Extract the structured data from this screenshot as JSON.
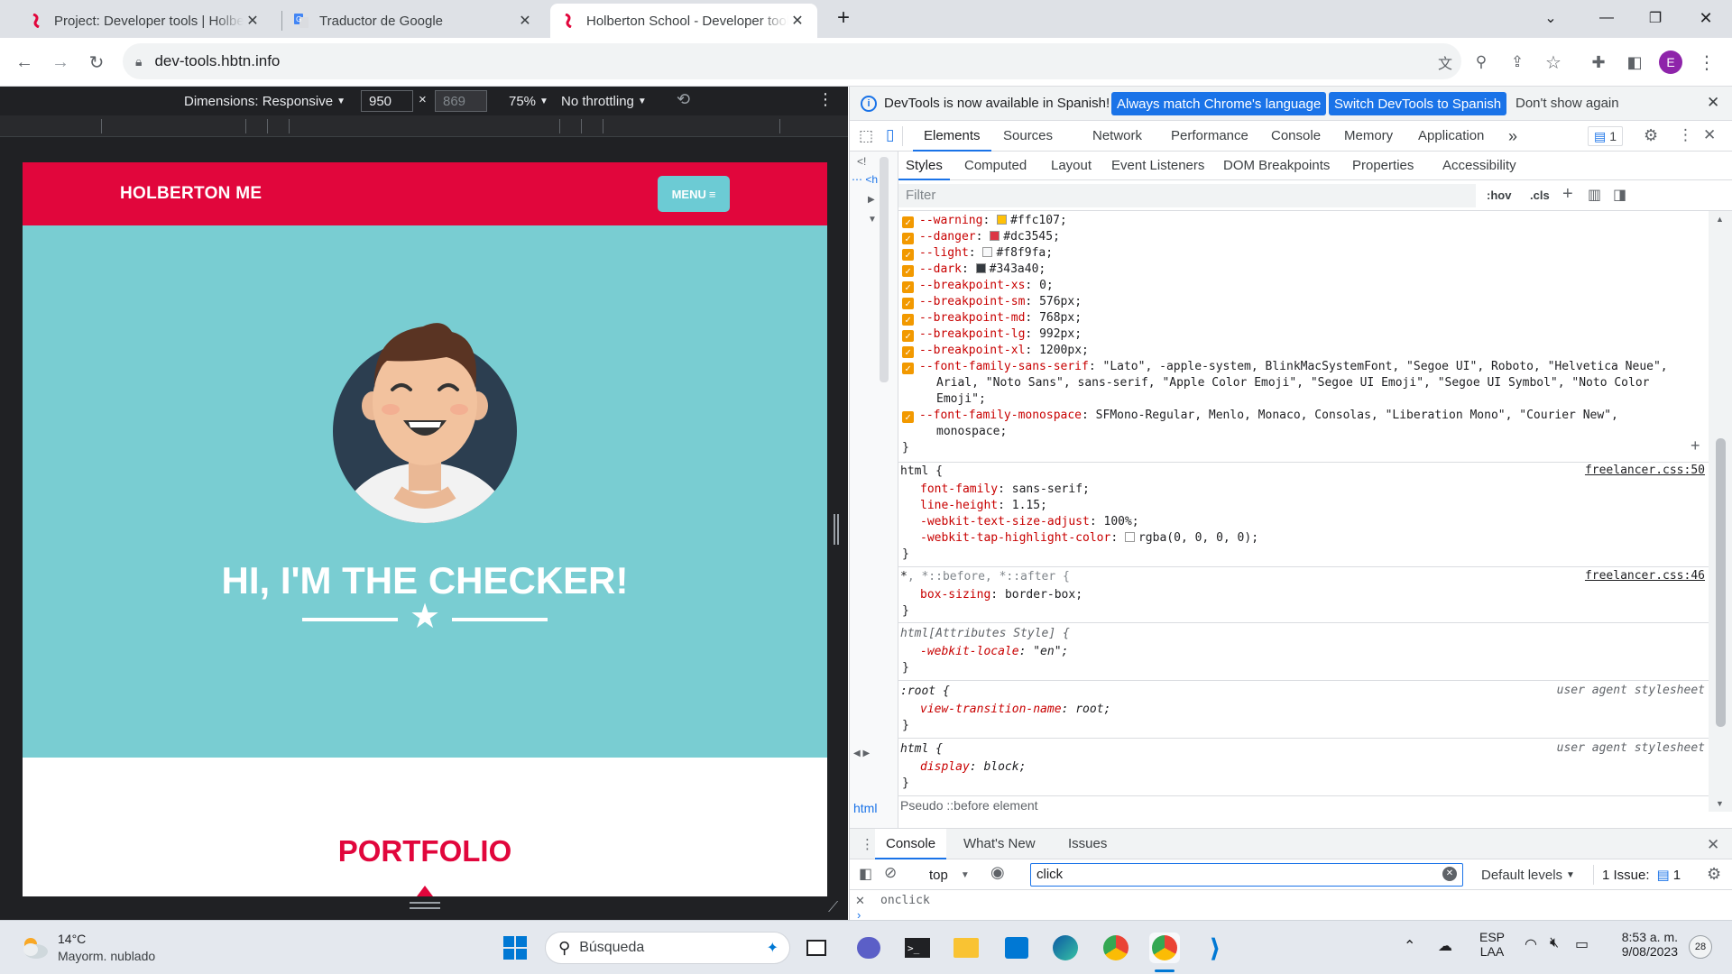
{
  "browser": {
    "tabs": [
      {
        "title": "Project: Developer tools | Holberton",
        "favicon": "holberton-icon"
      },
      {
        "title": "Traductor de Google",
        "favicon": "google-translate-icon"
      },
      {
        "title": "Holberton School - Developer tools",
        "favicon": "holberton-icon",
        "active": true
      }
    ],
    "url": "dev-tools.hbtn.info"
  },
  "device_toolbar": {
    "dimensions": "Dimensions: Responsive",
    "width": "950",
    "height_placeholder": "869",
    "times": "×",
    "zoom": "75%",
    "throttling": "No throttling"
  },
  "site": {
    "brand": "HOLBERTON ME",
    "menu": "MENU",
    "hero_title": "HI, I'M THE CHECKER!",
    "portfolio": "PORTFOLIO",
    "colors": {
      "nav": "#e1063c",
      "hero": "#79cdd2",
      "menu_button": "#6ccbd4"
    }
  },
  "devtools": {
    "infobar": {
      "message": "DevTools is now available in Spanish!",
      "btn_match": "Always match Chrome's language",
      "btn_switch": "Switch DevTools to Spanish",
      "btn_dismiss": "Don't show again"
    },
    "main_tabs": [
      "Elements",
      "Sources",
      "Network",
      "Performance",
      "Console",
      "Memory",
      "Application"
    ],
    "issues_count": "1",
    "sub_tabs": [
      "Styles",
      "Computed",
      "Layout",
      "Event Listeners",
      "DOM Breakpoints",
      "Properties",
      "Accessibility"
    ],
    "filter_placeholder": "Filter",
    "hov": ":hov",
    "cls": ".cls",
    "vars": [
      {
        "name": "--warning",
        "value": "#ffc107",
        "swatch": "#ffc107"
      },
      {
        "name": "--danger",
        "value": "#dc3545",
        "swatch": "#dc3545"
      },
      {
        "name": "--light",
        "value": "#f8f9fa",
        "swatch": "#f8f9fa"
      },
      {
        "name": "--dark",
        "value": "#343a40",
        "swatch": "#343a40"
      },
      {
        "name": "--breakpoint-xs",
        "value": "0"
      },
      {
        "name": "--breakpoint-sm",
        "value": "576px"
      },
      {
        "name": "--breakpoint-md",
        "value": "768px"
      },
      {
        "name": "--breakpoint-lg",
        "value": "992px"
      },
      {
        "name": "--breakpoint-xl",
        "value": "1200px"
      }
    ],
    "font_sans_name": "--font-family-sans-serif",
    "font_sans_1": "\"Lato\", -apple-system, BlinkMacSystemFont, \"Segoe UI\", Roboto, \"Helvetica Neue\",",
    "font_sans_2": "Arial, \"Noto Sans\", sans-serif, \"Apple Color Emoji\", \"Segoe UI Emoji\", \"Segoe UI Symbol\", \"Noto Color",
    "font_sans_3": "Emoji\";",
    "font_mono_name": "--font-family-monospace",
    "font_mono_1": "SFMono-Regular, Menlo, Monaco, Consolas, \"Liberation Mono\", \"Courier New\",",
    "font_mono_2": "monospace;",
    "html_rule": {
      "selector": "html {",
      "source": "freelancer.css:50",
      "props": [
        {
          "name": "font-family",
          "value": "sans-serif;"
        },
        {
          "name": "line-height",
          "value": "1.15;"
        },
        {
          "name": "-webkit-text-size-adjust",
          "value": "100%;"
        },
        {
          "name": "-webkit-tap-highlight-color",
          "value": "rgba(0, 0, 0, 0);"
        }
      ]
    },
    "universal_rule": {
      "selector_main": "*",
      "selector_rest": ", *::before, *::after {",
      "source": "freelancer.css:46",
      "prop": "box-sizing",
      "value": "border-box;"
    },
    "attr_rule": {
      "selector": "html[Attributes Style] {",
      "prop": "-webkit-locale",
      "value": "\"en\";"
    },
    "root_rule": {
      "selector": ":root {",
      "source": "user agent stylesheet",
      "prop": "view-transition-name",
      "value": "root;"
    },
    "html_ua_rule": {
      "selector": "html {",
      "source": "user agent stylesheet",
      "prop": "display",
      "value": "block;"
    },
    "pseudo_header": "Pseudo ::before element",
    "breadcrumb": "html",
    "drawer_tabs": [
      "Console",
      "What's New",
      "Issues"
    ],
    "console_context": "top",
    "console_filter": "click",
    "default_levels": "Default levels",
    "issues_label": "1 Issue:",
    "issues_num": "1",
    "console_line": "onclick"
  },
  "taskbar": {
    "weather_temp": "14°C",
    "weather_desc": "Mayorm. nublado",
    "search": "Búsqueda",
    "lang1": "ESP",
    "lang2": "LAA",
    "time": "8:53 a. m.",
    "date": "9/08/2023",
    "notif": "28"
  }
}
